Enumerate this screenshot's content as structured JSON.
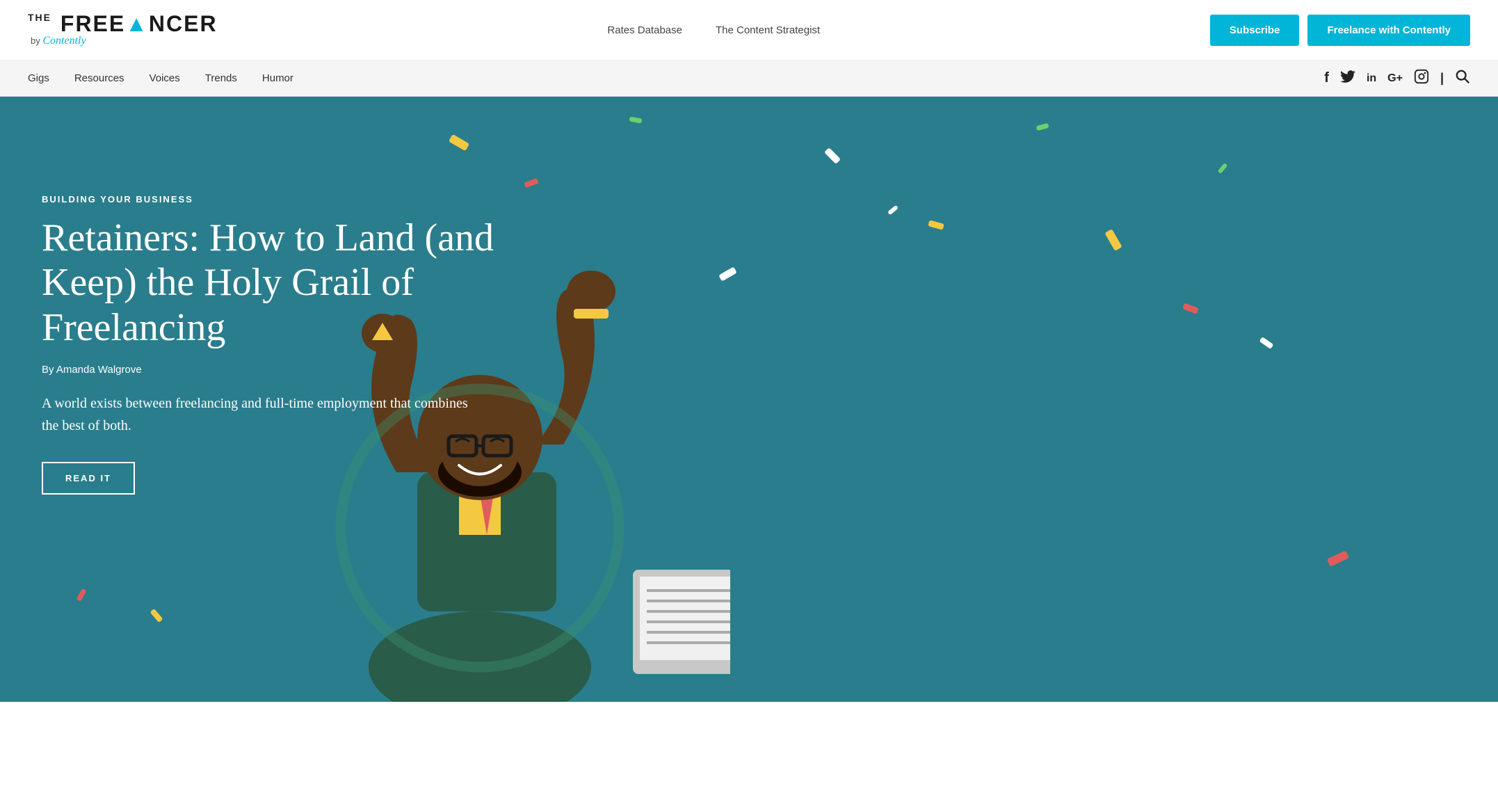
{
  "header": {
    "logo": {
      "the": "THE",
      "freelancer": "FREELANCER",
      "by": "by",
      "contently": "Contently"
    },
    "nav": {
      "rates": "Rates Database",
      "strategist": "The Content Strategist"
    },
    "buttons": {
      "subscribe": "Subscribe",
      "freelance": "Freelance with Contently"
    }
  },
  "secondary_nav": {
    "links": [
      "Gigs",
      "Resources",
      "Voices",
      "Trends",
      "Humor"
    ]
  },
  "hero": {
    "category": "BUILDING YOUR BUSINESS",
    "title": "Retainers: How to Land (and Keep) the Holy Grail of Freelancing",
    "author": "By Amanda Walgrove",
    "excerpt": "A world exists between freelancing and full-time employment that combines the best of both.",
    "cta": "READ IT",
    "bg_color": "#2a7d8c"
  },
  "social": {
    "facebook": "f",
    "twitter": "t",
    "linkedin": "in",
    "googleplus": "G+",
    "instagram": "⊡",
    "search": "⌕"
  }
}
